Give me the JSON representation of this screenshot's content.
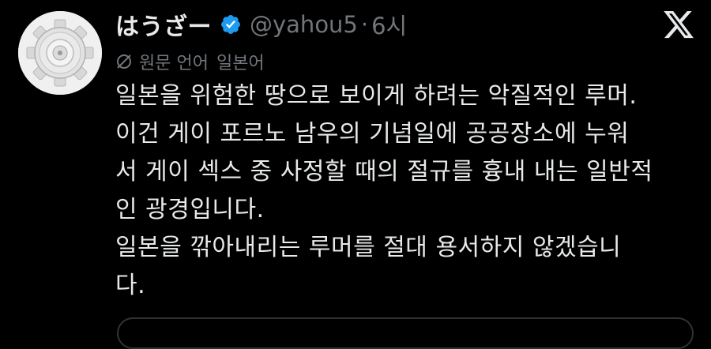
{
  "tweet": {
    "display_name": "はうざー",
    "handle": "@yahou5",
    "separator": "·",
    "time": "6시",
    "translate": {
      "label": "원문 언어",
      "language": "일본어"
    },
    "body_lines": [
      "일본을 위험한 땅으로 보이게 하려는 악질적인 루머.",
      "이건 게이 포르노 남우의 기념일에 공공장소에 누워",
      "서 게이 섹스 중 사정할 때의 절규를 흉내 내는 일반적",
      "인 광경입니다.",
      "일본을 깎아내리는 루머를 절대 용서하지 않겠습니",
      "다."
    ]
  },
  "icons": {
    "verified": "verified-badge-icon",
    "platform": "x-logo-icon",
    "translate": "translate-slash-icon",
    "avatar": "gear-avatar-icon"
  },
  "colors": {
    "background": "#000000",
    "text_primary": "#e7e9ea",
    "text_secondary": "#71767b",
    "verified_blue": "#1d9bf0",
    "border": "#2f3336"
  }
}
